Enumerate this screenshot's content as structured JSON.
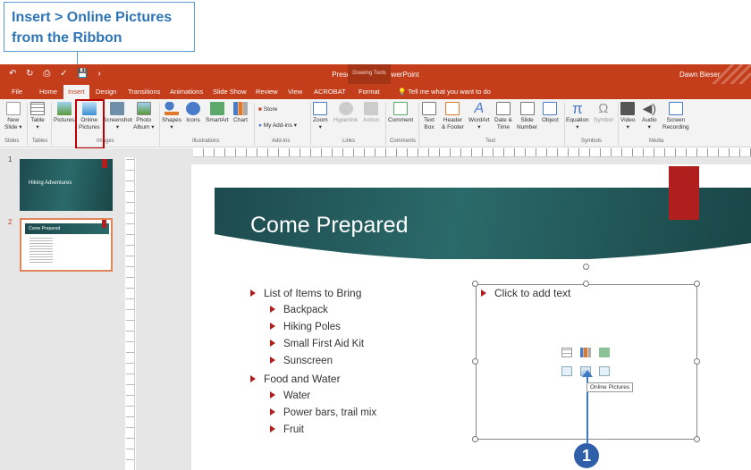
{
  "callout": {
    "line1": "Insert > Online Pictures",
    "line2": "from the Ribbon"
  },
  "window": {
    "title": "Presentation5 - PowerPoint",
    "contextual_tab": "Drawing Tools",
    "user": "Dawn Bieser"
  },
  "tabs": [
    "File",
    "Home",
    "Insert",
    "Design",
    "Transitions",
    "Animations",
    "Slide Show",
    "Review",
    "View",
    "ACROBAT",
    "Format"
  ],
  "active_tab": "Insert",
  "tell_me": "Tell me what you want to do",
  "ribbon": {
    "new_slide": [
      "New",
      "Slide"
    ],
    "table": "Table",
    "pictures": "Pictures",
    "online_pictures": [
      "Online",
      "Pictures"
    ],
    "screenshot": "Screenshot",
    "photo_album": [
      "Photo",
      "Album"
    ],
    "shapes": "Shapes",
    "icons": "Icons",
    "smartart": "SmartArt",
    "chart": "Chart",
    "store": "Store",
    "my_addins": "My Add-ins",
    "zoom": "Zoom",
    "hyperlink": "Hyperlink",
    "action": "Action",
    "comment": "Comment",
    "text_box": [
      "Text",
      "Box"
    ],
    "header_footer": [
      "Header",
      "& Footer"
    ],
    "wordart": "WordArt",
    "date_time": [
      "Date &",
      "Time"
    ],
    "slide_number": [
      "Slide",
      "Number"
    ],
    "object": "Object",
    "equation": "Equation",
    "symbol": "Symbol",
    "video": "Video",
    "audio": "Audio",
    "screen_recording": [
      "Screen",
      "Recording"
    ],
    "groups": {
      "slides": "Slides",
      "tables": "Tables",
      "images": "Images",
      "illustrations": "Illustrations",
      "addins": "Add-ins",
      "links": "Links",
      "comments": "Comments",
      "text": "Text",
      "symbols": "Symbols",
      "media": "Media"
    }
  },
  "thumbnails": [
    {
      "num": "1",
      "title": "Hiking Adventures"
    },
    {
      "num": "2",
      "title": "Come Prepared"
    }
  ],
  "slide": {
    "title": "Come Prepared",
    "bullets": [
      {
        "text": "List of Items to Bring",
        "level": 1
      },
      {
        "text": "Backpack",
        "level": 2
      },
      {
        "text": "Hiking Poles",
        "level": 2
      },
      {
        "text": "Small First Aid Kit",
        "level": 2
      },
      {
        "text": "Sunscreen",
        "level": 2
      },
      {
        "text": "Food and Water",
        "level": 1
      },
      {
        "text": "Water",
        "level": 2
      },
      {
        "text": "Power bars, trail mix",
        "level": 2
      },
      {
        "text": "Fruit",
        "level": 2
      }
    ],
    "placeholder": "Click to add text",
    "tooltip": "Online Pictures"
  },
  "marker": "1",
  "colors": {
    "accent": "#c43e1c",
    "callout": "#2e75b6",
    "highlight": "#c00000",
    "banner": "#1d4a4e",
    "bookmark": "#b01e1e"
  }
}
